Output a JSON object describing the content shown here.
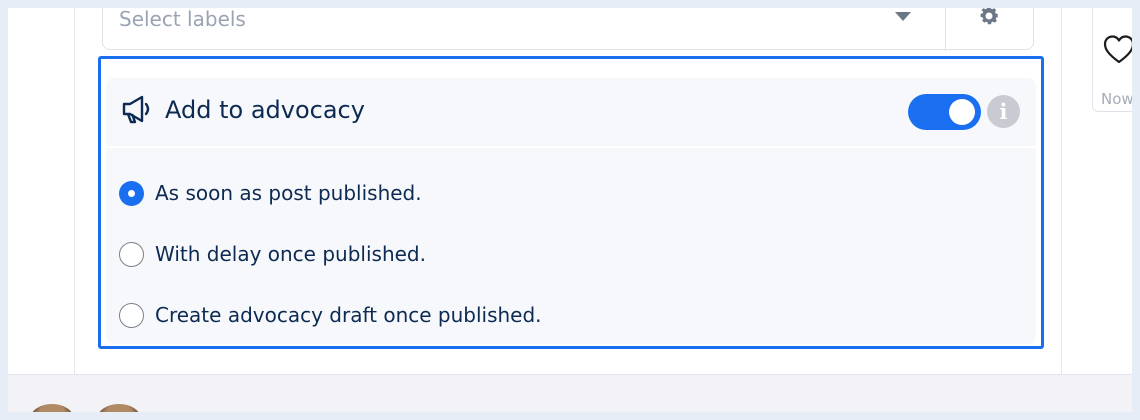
{
  "labels": {
    "placeholder": "Select labels",
    "caret_icon": "caret-down-icon",
    "settings_icon": "gear-icon"
  },
  "advocacy": {
    "icon": "megaphone-icon",
    "title": "Add to advocacy",
    "toggle_on": true,
    "info_icon": "info-icon",
    "info_glyph": "i",
    "options": [
      {
        "label": "As soon as post published.",
        "selected": true
      },
      {
        "label": "With delay once published.",
        "selected": false
      },
      {
        "label": "Create advocacy draft once published.",
        "selected": false
      }
    ]
  },
  "right_card": {
    "icon": "heart-icon",
    "time": "Now"
  },
  "colors": {
    "accent": "#1a6ff0",
    "text": "#0d2a52",
    "muted": "#9aa3b2"
  }
}
